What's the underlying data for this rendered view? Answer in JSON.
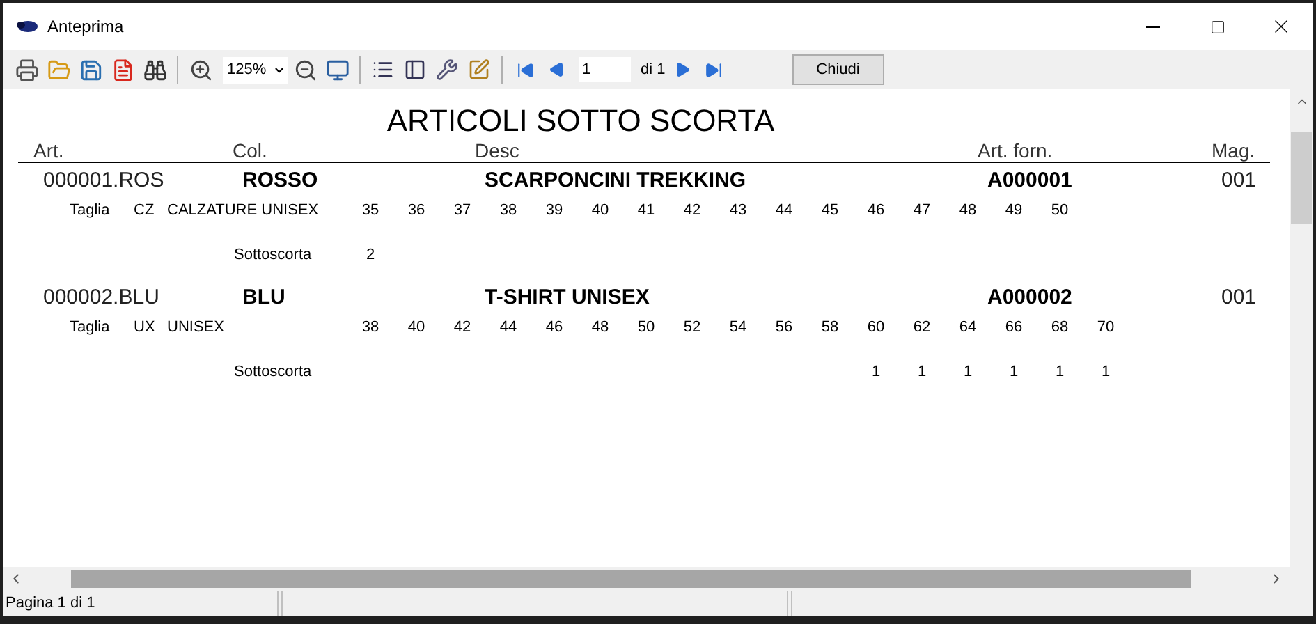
{
  "window": {
    "title": "Anteprima"
  },
  "toolbar": {
    "zoom": "125%",
    "page": "1",
    "page_count": "di 1",
    "close_button": "Chiudi"
  },
  "report": {
    "title": "ARTICOLI SOTTO SCORTA",
    "columns": [
      "Art.",
      "Col.",
      "Desc",
      "Art. forn.",
      "Mag."
    ],
    "articles": [
      {
        "code": "000001.ROS",
        "colour_name": "ROSSO",
        "description": "SCARPONCINI TREKKING",
        "supplier_code": "A000001",
        "warehouse": "001",
        "size_label": "Taglia",
        "size_group": "CZ",
        "size_group_name": "CALZATURE UNISEX",
        "shortage_label": "Sottoscorta",
        "sizes": [
          {
            "size": "35",
            "shortage": "2"
          },
          {
            "size": "36"
          },
          {
            "size": "37"
          },
          {
            "size": "38"
          },
          {
            "size": "39"
          },
          {
            "size": "40"
          },
          {
            "size": "41"
          },
          {
            "size": "42"
          },
          {
            "size": "43"
          },
          {
            "size": "44"
          },
          {
            "size": "45"
          },
          {
            "size": "46"
          },
          {
            "size": "47"
          },
          {
            "size": "48"
          },
          {
            "size": "49"
          },
          {
            "size": "50"
          }
        ]
      },
      {
        "code": "000002.BLU",
        "colour_name": "BLU",
        "description": "T-SHIRT UNISEX",
        "supplier_code": "A000002",
        "warehouse": "001",
        "size_label": "Taglia",
        "size_group": "UX",
        "size_group_name": "UNISEX",
        "shortage_label": "Sottoscorta",
        "sizes": [
          {
            "size": "38"
          },
          {
            "size": "40"
          },
          {
            "size": "42"
          },
          {
            "size": "44"
          },
          {
            "size": "46"
          },
          {
            "size": "48"
          },
          {
            "size": "50"
          },
          {
            "size": "52"
          },
          {
            "size": "54"
          },
          {
            "size": "56"
          },
          {
            "size": "58"
          },
          {
            "size": "60",
            "shortage": "1"
          },
          {
            "size": "62",
            "shortage": "1"
          },
          {
            "size": "64",
            "shortage": "1"
          },
          {
            "size": "66",
            "shortage": "1"
          },
          {
            "size": "68",
            "shortage": "1"
          },
          {
            "size": "70",
            "shortage": "1"
          }
        ]
      }
    ]
  },
  "status_bar": [
    "Pagina 1 di 1"
  ]
}
